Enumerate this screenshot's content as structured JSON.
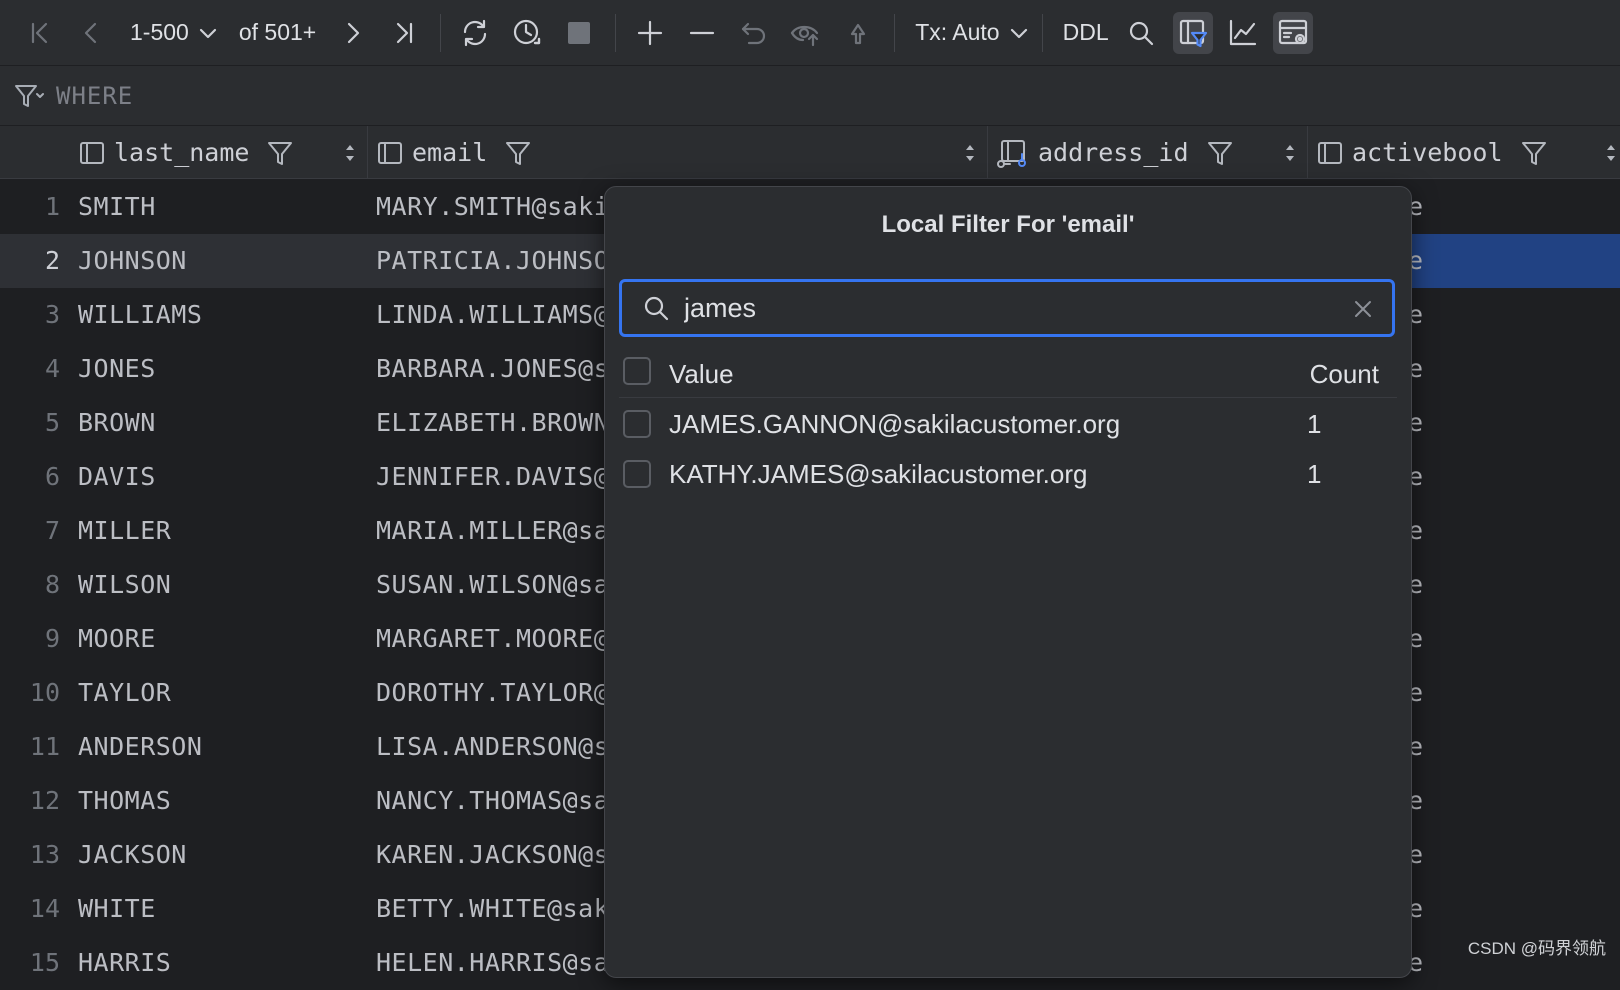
{
  "toolbar": {
    "page_range": "1-500",
    "page_total": "of 501+",
    "tx_mode": "Tx: Auto",
    "ddl_label": "DDL"
  },
  "where_bar": {
    "label": "WHERE"
  },
  "columns": [
    {
      "name": "last_name",
      "icon": "column-icon"
    },
    {
      "name": "email",
      "icon": "column-icon"
    },
    {
      "name": "address_id",
      "icon": "foreign-key-column-icon"
    },
    {
      "name": "activebool",
      "icon": "column-icon"
    }
  ],
  "rows": [
    {
      "num": "1",
      "last_name": "SMITH",
      "email": "MARY.SMITH@saki",
      "active": "e"
    },
    {
      "num": "2",
      "last_name": "JOHNSON",
      "email": "PATRICIA.JOHNSO",
      "active": "e"
    },
    {
      "num": "3",
      "last_name": "WILLIAMS",
      "email": "LINDA.WILLIAMS@",
      "active": "e"
    },
    {
      "num": "4",
      "last_name": "JONES",
      "email": "BARBARA.JONES@s",
      "active": "e"
    },
    {
      "num": "5",
      "last_name": "BROWN",
      "email": "ELIZABETH.BROWN",
      "active": "e"
    },
    {
      "num": "6",
      "last_name": "DAVIS",
      "email": "JENNIFER.DAVIS@",
      "active": "e"
    },
    {
      "num": "7",
      "last_name": "MILLER",
      "email": "MARIA.MILLER@sa",
      "active": "e"
    },
    {
      "num": "8",
      "last_name": "WILSON",
      "email": "SUSAN.WILSON@sa",
      "active": "e"
    },
    {
      "num": "9",
      "last_name": "MOORE",
      "email": "MARGARET.MOORE@",
      "active": "e"
    },
    {
      "num": "10",
      "last_name": "TAYLOR",
      "email": "DOROTHY.TAYLOR@",
      "active": "e"
    },
    {
      "num": "11",
      "last_name": "ANDERSON",
      "email": "LISA.ANDERSON@s",
      "active": "e"
    },
    {
      "num": "12",
      "last_name": "THOMAS",
      "email": "NANCY.THOMAS@sa",
      "active": "e"
    },
    {
      "num": "13",
      "last_name": "JACKSON",
      "email": "KAREN.JACKSON@s",
      "active": "e"
    },
    {
      "num": "14",
      "last_name": "WHITE",
      "email": "BETTY.WHITE@sak",
      "active": "e"
    },
    {
      "num": "15",
      "last_name": "HARRIS",
      "email": "HELEN.HARRIS@sa",
      "active": "e"
    }
  ],
  "popup": {
    "title": "Local Filter For 'email'",
    "search_value": "james",
    "header_value": "Value",
    "header_count": "Count",
    "items": [
      {
        "value": "JAMES.GANNON@sakilacustomer.org",
        "count": "1"
      },
      {
        "value": "KATHY.JAMES@sakilacustomer.org",
        "count": "1"
      }
    ]
  },
  "watermark": "CSDN @码界领航"
}
